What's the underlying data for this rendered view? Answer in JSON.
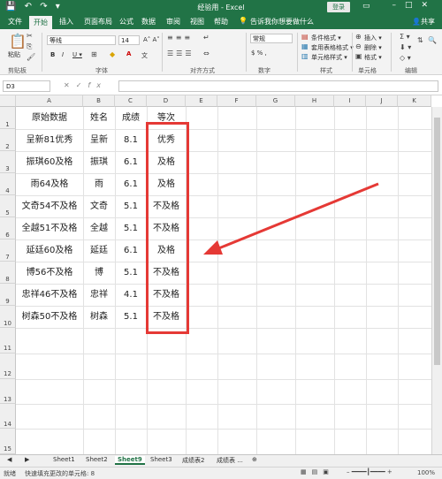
{
  "titlebar": {
    "title": "经验用 - Excel",
    "login": "登录",
    "quick_access": "💾 ↶ ↷ ▾"
  },
  "ribbon_tabs": [
    "文件",
    "开始",
    "插入",
    "页面布局",
    "公式",
    "数据",
    "审阅",
    "视图",
    "帮助"
  ],
  "tell_me": "告诉我你想要做什么",
  "share": "共享",
  "ribbon": {
    "paste": "粘贴",
    "clipboard": "剪贴板",
    "font_name": "等线",
    "font_size": "14",
    "font_group": "字体",
    "align_group": "对齐方式",
    "number_format": "常规",
    "number_group": "数字",
    "cond_format": "条件格式 ▾",
    "table_format": "套用表格格式 ▾",
    "cell_style": "单元格样式 ▾",
    "style_group": "样式",
    "insert": "插入 ▾",
    "delete": "删除 ▾",
    "format": "格式 ▾",
    "cells_group": "单元格",
    "edit_group": "编辑"
  },
  "namebox": "D3",
  "columns": [
    "A",
    "B",
    "C",
    "D",
    "E",
    "F",
    "G",
    "H",
    "I",
    "J",
    "K"
  ],
  "rows": [
    "1",
    "2",
    "3",
    "4",
    "5",
    "6",
    "7",
    "8",
    "9",
    "10",
    "11",
    "12",
    "13",
    "14",
    "15"
  ],
  "table": [
    [
      "原始数据",
      "姓名",
      "成绩",
      "等次"
    ],
    [
      "呈新81优秀",
      "呈新",
      "8.1",
      "优秀"
    ],
    [
      "振琪60及格",
      "振琪",
      "6.1",
      "及格"
    ],
    [
      "雨64及格",
      "雨",
      "6.1",
      "及格"
    ],
    [
      "文奇54不及格",
      "文奇",
      "5.1",
      "不及格"
    ],
    [
      "全越51不及格",
      "全越",
      "5.1",
      "不及格"
    ],
    [
      "延廷60及格",
      "延廷",
      "6.1",
      "及格"
    ],
    [
      "博56不及格",
      "博",
      "5.1",
      "不及格"
    ],
    [
      "忠祥46不及格",
      "忠祥",
      "4.1",
      "不及格"
    ],
    [
      "树森50不及格",
      "树森",
      "5.1",
      "不及格"
    ]
  ],
  "sheets": [
    "Sheet1",
    "Sheet2",
    "Sheet9",
    "Sheet3",
    "成绩表2",
    "成绩表 ..."
  ],
  "status": {
    "mode": "就绪",
    "message": "快速填充更改的单元格: 8",
    "zoom": "100%"
  },
  "colors": {
    "excel_green": "#217346",
    "highlight_red": "#e53935"
  }
}
